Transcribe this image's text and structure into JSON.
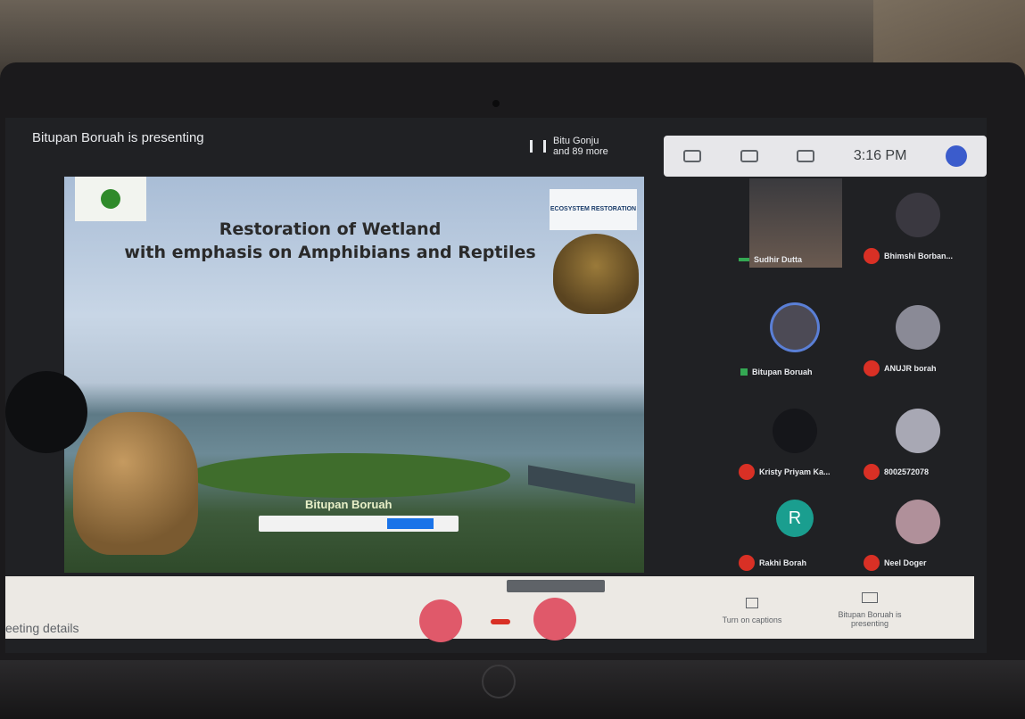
{
  "presenting_label": "Bitupan Boruah is presenting",
  "viewers": {
    "line1": "Bitu Gonju",
    "line2": "and 89 more"
  },
  "topbar": {
    "time": "3:16 PM"
  },
  "slide": {
    "title_line1": "Restoration of Wetland",
    "title_line2": "with emphasis on Amphibians and Reptiles",
    "author": "Bitupan Boruah",
    "right_logo_text": "ECOSYSTEM RESTORATION"
  },
  "participants": [
    {
      "name": "Sudhir Dutta",
      "state": "speaking"
    },
    {
      "name": "Bhimshi Borban...",
      "state": "muted"
    },
    {
      "name": "Bitupan Boruah",
      "state": "speaking"
    },
    {
      "name": "ANUJR borah",
      "state": "muted"
    },
    {
      "name": "Kristy Priyam Ka...",
      "state": "muted"
    },
    {
      "name": "8002572078",
      "state": "muted"
    },
    {
      "name": "Rakhi Borah",
      "state": "muted",
      "letter": "R"
    },
    {
      "name": "Neel Doger",
      "state": "muted"
    }
  ],
  "bottombar": {
    "meeting_details": "eeting details",
    "captions": "Turn on captions",
    "presenting": "Bitupan Boruah is presenting"
  },
  "colors": {
    "end_call": "#e0596a",
    "avatar_teal": "#1a9e8f",
    "muted": "#d93025",
    "speaking": "#34a853"
  }
}
